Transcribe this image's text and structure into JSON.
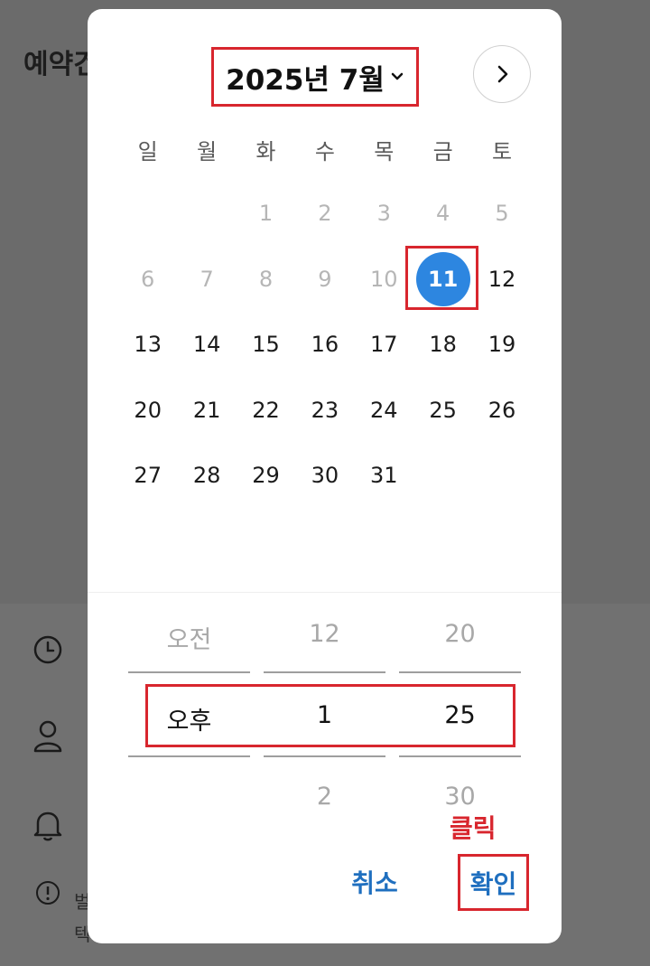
{
  "background": {
    "title": "예약건",
    "note_line1": "벌",
    "note_line2": "텍"
  },
  "dialog": {
    "month_label": "2025년 7월",
    "weekdays": [
      "일",
      "월",
      "화",
      "수",
      "목",
      "금",
      "토"
    ],
    "days": {
      "d1": "1",
      "d2": "2",
      "d3": "3",
      "d4": "4",
      "d5": "5",
      "d6": "6",
      "d7": "7",
      "d8": "8",
      "d9": "9",
      "d10": "10",
      "d11": "11",
      "d12": "12",
      "d13": "13",
      "d14": "14",
      "d15": "15",
      "d16": "16",
      "d17": "17",
      "d18": "18",
      "d19": "19",
      "d20": "20",
      "d21": "21",
      "d22": "22",
      "d23": "23",
      "d24": "24",
      "d25": "25",
      "d26": "26",
      "d27": "27",
      "d28": "28",
      "d29": "29",
      "d30": "30",
      "d31": "31"
    },
    "selected_day": "11",
    "time_picker": {
      "ampm": {
        "prev": "오전",
        "current": "오후"
      },
      "hour": {
        "prev": "12",
        "current": "1",
        "next": "2"
      },
      "minute": {
        "prev": "20",
        "current": "25",
        "next": "30"
      }
    },
    "annotation": "클릭",
    "cancel_label": "취소",
    "confirm_label": "확인"
  },
  "colors": {
    "accent": "#2d86e0",
    "button_text": "#1f6fbf",
    "highlight_red": "#d8262e"
  }
}
